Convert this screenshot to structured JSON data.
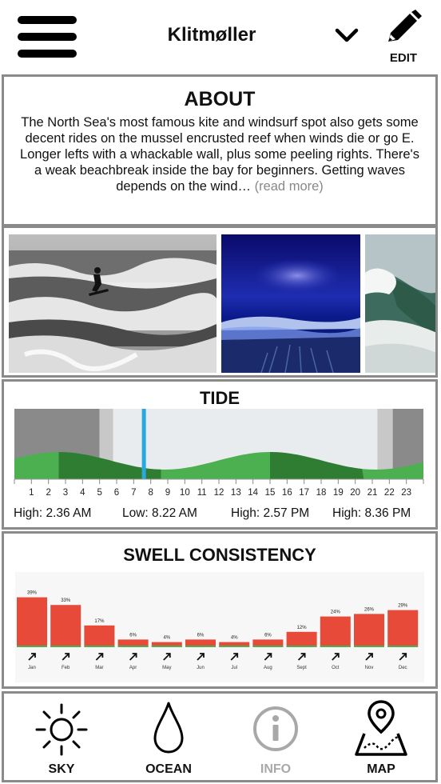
{
  "header": {
    "title": "Klitmøller",
    "edit_label": "EDIT"
  },
  "about": {
    "heading": "ABOUT",
    "text": "The North Sea's most famous kite and windsurf spot also gets some decent rides on the mussel encrusted reef when winds die or go E. Longer lefts with a whackable wall, plus some peeling rights. There's a weak beachbreak inside the bay for beginners. Getting waves depends on the wind…",
    "read_more": "(read more)"
  },
  "tide": {
    "heading": "TIDE",
    "hours": [
      "1",
      "2",
      "3",
      "4",
      "5",
      "6",
      "7",
      "8",
      "9",
      "10",
      "11",
      "12",
      "13",
      "14",
      "15",
      "16",
      "17",
      "18",
      "19",
      "20",
      "21",
      "22",
      "23"
    ],
    "times": [
      "High: 2.36 AM",
      "Low: 8.22 AM",
      "High: 2.57 PM",
      "High: 8.36 PM"
    ],
    "colors": {
      "night": "#8a8a8a",
      "twilight": "#c8c8c8",
      "day": "#e8ecee",
      "tide_light": "#4caf50",
      "tide_dark": "#2e7d32",
      "now": "#29a8e0"
    }
  },
  "swell": {
    "heading": "SWELL CONSISTENCY",
    "chart_data": {
      "type": "bar",
      "categories": [
        "Jan",
        "Feb",
        "Mar",
        "Apr",
        "May",
        "Jun",
        "Jul",
        "Aug",
        "Sept",
        "Oct",
        "Nov",
        "Dec"
      ],
      "values": [
        39,
        33,
        17,
        6,
        4,
        6,
        4,
        6,
        12,
        24,
        26,
        29
      ],
      "value_labels": [
        "39%",
        "33%",
        "17%",
        "6%",
        "4%",
        "6%",
        "4%",
        "6%",
        "12%",
        "24%",
        "26%",
        "29%"
      ],
      "ylim": [
        0,
        40
      ],
      "bar_color": "#e84a3a",
      "base_color": "#4caf50"
    }
  },
  "nav": {
    "sky": "SKY",
    "ocean": "OCEAN",
    "info": "INFO",
    "map": "MAP"
  }
}
